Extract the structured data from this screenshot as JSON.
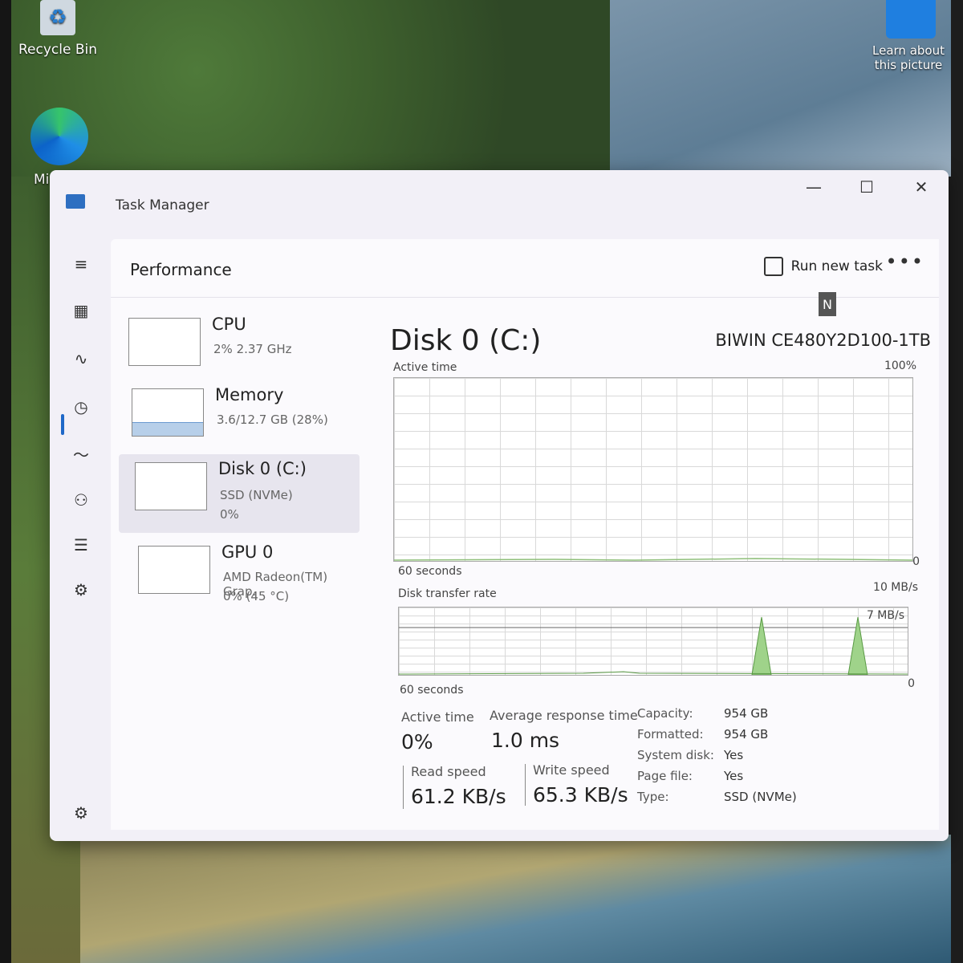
{
  "desktop": {
    "recycle_bin": "Recycle Bin",
    "edge_partial": "Mi",
    "learn_line1": "Learn about",
    "learn_line2": "this picture"
  },
  "window": {
    "title": "Task Manager",
    "minimize": "—",
    "maximize": "☐",
    "close": "✕"
  },
  "nav": {
    "hamburger": "≡",
    "processes": "▦",
    "performance": "∿",
    "history": "◷",
    "startup": "〜",
    "users": "⚇",
    "details": "☰",
    "services": "⚙",
    "settings": "⚙"
  },
  "header": {
    "page_title": "Performance",
    "run_new_task": "Run new task",
    "more": "•••"
  },
  "devices": [
    {
      "name": "CPU",
      "line1": "2% 2.37 GHz",
      "line2": ""
    },
    {
      "name": "Memory",
      "line1": "3.6/12.7 GB (28%)",
      "line2": "",
      "usage_percent": 28
    },
    {
      "name": "Disk 0 (C:)",
      "line1": "SSD (NVMe)",
      "line2": "0%"
    },
    {
      "name": "GPU 0",
      "line1": "AMD Radeon(TM) Grap.",
      "line2": "0% (45 °C)"
    }
  ],
  "main": {
    "title": "Disk 0 (C:)",
    "model": "BIWIN CE480Y2D100-1TB",
    "badge": "N",
    "active_time_label": "Active time",
    "active_max": "100%",
    "active_min": "0",
    "active_seconds": "60 seconds",
    "rate_label": "Disk transfer rate",
    "rate_max": "10 MB/s",
    "rate_mark": "7 MB/s",
    "rate_min": "0",
    "rate_seconds": "60 seconds"
  },
  "stats": {
    "active_time_label": "Active time",
    "active_time_value": "0%",
    "avg_response_label": "Average response time",
    "avg_response_value": "1.0 ms",
    "read_label": "Read speed",
    "read_value": "61.2 KB/s",
    "write_label": "Write speed",
    "write_value": "65.3 KB/s"
  },
  "properties": [
    {
      "key": "Capacity:",
      "value": "954 GB"
    },
    {
      "key": "Formatted:",
      "value": "954 GB"
    },
    {
      "key": "System disk:",
      "value": "Yes"
    },
    {
      "key": "Page file:",
      "value": "Yes"
    },
    {
      "key": "Type:",
      "value": "SSD (NVMe)"
    }
  ]
}
